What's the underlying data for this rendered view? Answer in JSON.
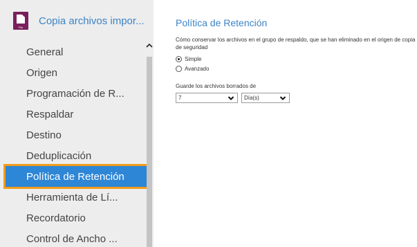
{
  "sidebar": {
    "app_title": "Copia archivos impor...",
    "app_icon": "backup-document-icon",
    "app_icon_tag": "File",
    "items": [
      {
        "label": "General"
      },
      {
        "label": "Origen"
      },
      {
        "label": "Programación de R..."
      },
      {
        "label": "Respaldar"
      },
      {
        "label": "Destino"
      },
      {
        "label": "Deduplicación"
      },
      {
        "label": "Política de Retención"
      },
      {
        "label": "Herramienta de Lí..."
      },
      {
        "label": "Recordatorio"
      },
      {
        "label": "Control de Ancho ..."
      }
    ],
    "active_item": "Política de Retención",
    "scroll_up_icon": "chevron-up-icon"
  },
  "main": {
    "title": "Política de Retención",
    "description": "Cómo conservar los archivos en el grupo de respaldo, que se han eliminado en el origen de copia de seguridad",
    "options": [
      {
        "label": "Simple",
        "checked": true
      },
      {
        "label": "Avanzado",
        "checked": false
      }
    ],
    "keep_label": "Guarde los archivos borrados de",
    "number_value": "7",
    "unit_value": "Día(s)"
  },
  "colors": {
    "accent": "#3c83c6",
    "active_bg": "#2e86d6",
    "active_outline": "#f39c18",
    "app_icon_bg": "#7b1f5c",
    "sidebar_bg": "#ededed"
  }
}
